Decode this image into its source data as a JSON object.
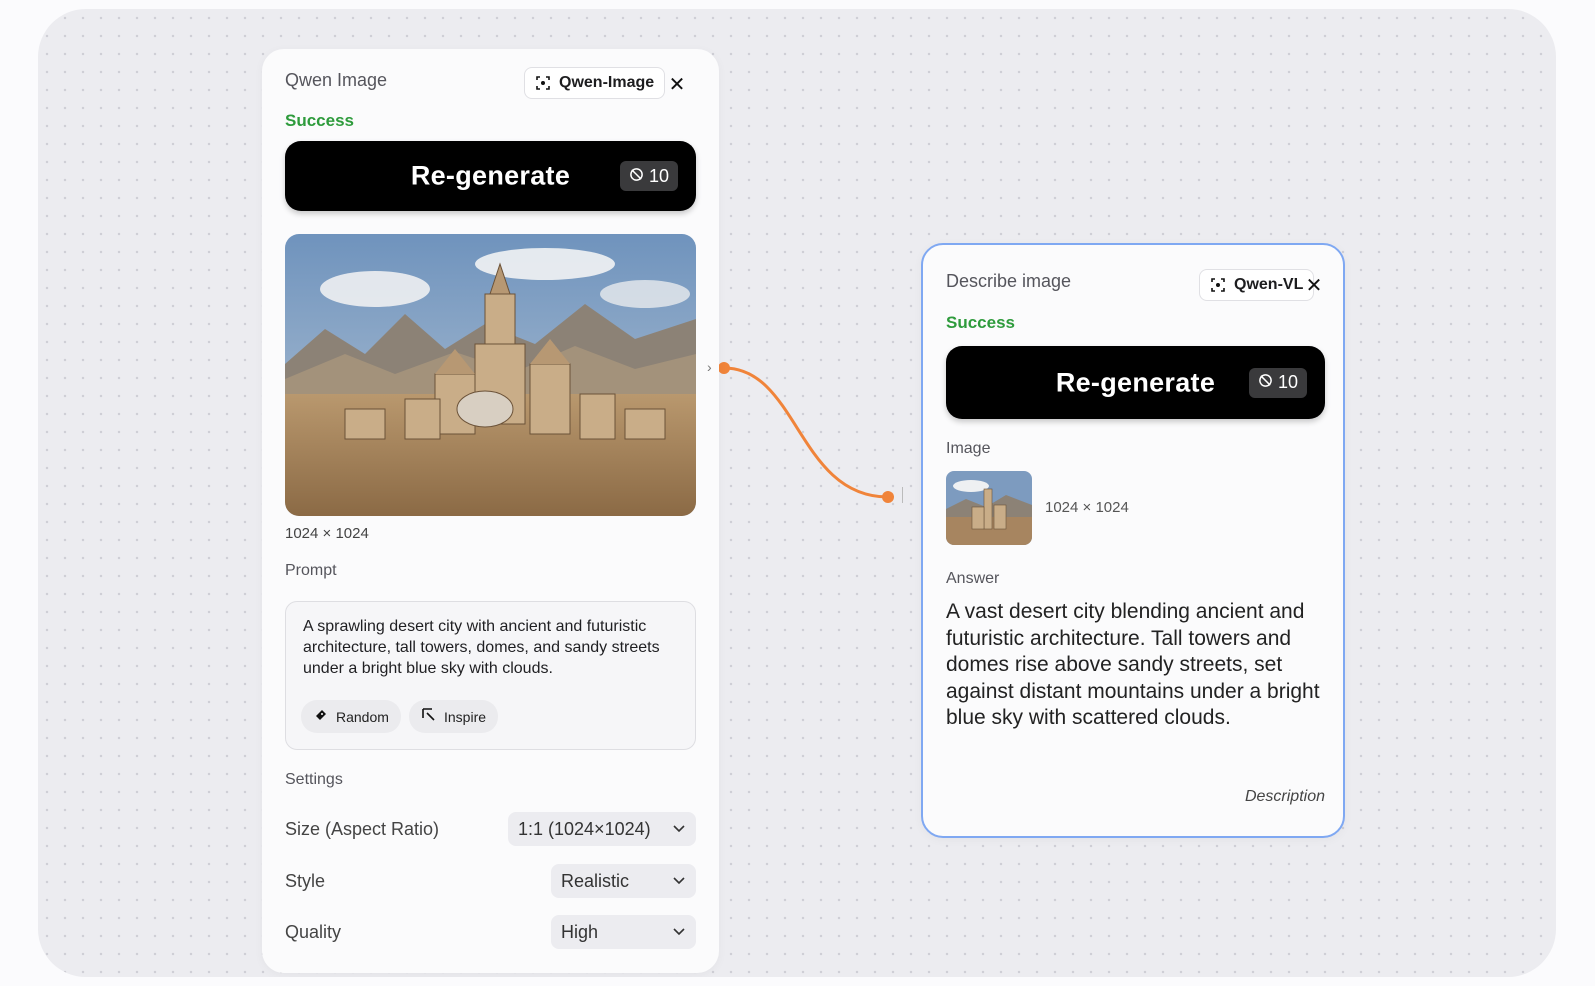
{
  "colors": {
    "accent_orange": "#f0843a",
    "success_green": "#2e9b3c",
    "selected_border": "#7fa8f2"
  },
  "image_node": {
    "title": "Qwen Image",
    "model": "Qwen-Image",
    "status": "Success",
    "regenerate_label": "Re-generate",
    "credits": "10",
    "image_size": "1024 × 1024",
    "prompt_label": "Prompt",
    "prompt_text": "A sprawling desert city with ancient and futuristic architecture, tall towers, domes, and sandy streets under a bright blue sky with clouds.",
    "random_label": "Random",
    "inspire_label": "Inspire",
    "settings_label": "Settings",
    "size_label": "Size (Aspect Ratio)",
    "size_value": "1:1 (1024×1024)",
    "style_label": "Style",
    "style_value": "Realistic",
    "quality_label": "Quality",
    "quality_value": "High"
  },
  "describe_node": {
    "title": "Describe image",
    "model": "Qwen-VL",
    "status": "Success",
    "regenerate_label": "Re-generate",
    "credits": "10",
    "image_label": "Image",
    "image_size": "1024 × 1024",
    "answer_label": "Answer",
    "answer_text": "A vast desert city blending ancient and futuristic architecture. Tall towers and domes rise above sandy streets, set against distant mountains under a bright blue sky with scattered clouds.",
    "description_tag": "Description"
  }
}
